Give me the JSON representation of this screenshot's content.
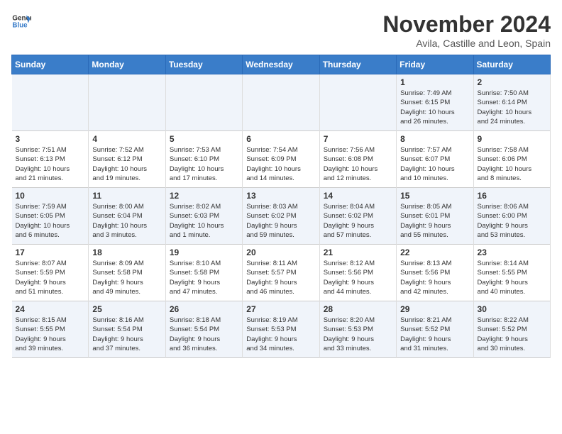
{
  "logo": {
    "line1": "General",
    "line2": "Blue"
  },
  "title": "November 2024",
  "subtitle": "Avila, Castille and Leon, Spain",
  "days_of_week": [
    "Sunday",
    "Monday",
    "Tuesday",
    "Wednesday",
    "Thursday",
    "Friday",
    "Saturday"
  ],
  "weeks": [
    [
      {
        "day": "",
        "info": ""
      },
      {
        "day": "",
        "info": ""
      },
      {
        "day": "",
        "info": ""
      },
      {
        "day": "",
        "info": ""
      },
      {
        "day": "",
        "info": ""
      },
      {
        "day": "1",
        "info": "Sunrise: 7:49 AM\nSunset: 6:15 PM\nDaylight: 10 hours\nand 26 minutes."
      },
      {
        "day": "2",
        "info": "Sunrise: 7:50 AM\nSunset: 6:14 PM\nDaylight: 10 hours\nand 24 minutes."
      }
    ],
    [
      {
        "day": "3",
        "info": "Sunrise: 7:51 AM\nSunset: 6:13 PM\nDaylight: 10 hours\nand 21 minutes."
      },
      {
        "day": "4",
        "info": "Sunrise: 7:52 AM\nSunset: 6:12 PM\nDaylight: 10 hours\nand 19 minutes."
      },
      {
        "day": "5",
        "info": "Sunrise: 7:53 AM\nSunset: 6:10 PM\nDaylight: 10 hours\nand 17 minutes."
      },
      {
        "day": "6",
        "info": "Sunrise: 7:54 AM\nSunset: 6:09 PM\nDaylight: 10 hours\nand 14 minutes."
      },
      {
        "day": "7",
        "info": "Sunrise: 7:56 AM\nSunset: 6:08 PM\nDaylight: 10 hours\nand 12 minutes."
      },
      {
        "day": "8",
        "info": "Sunrise: 7:57 AM\nSunset: 6:07 PM\nDaylight: 10 hours\nand 10 minutes."
      },
      {
        "day": "9",
        "info": "Sunrise: 7:58 AM\nSunset: 6:06 PM\nDaylight: 10 hours\nand 8 minutes."
      }
    ],
    [
      {
        "day": "10",
        "info": "Sunrise: 7:59 AM\nSunset: 6:05 PM\nDaylight: 10 hours\nand 6 minutes."
      },
      {
        "day": "11",
        "info": "Sunrise: 8:00 AM\nSunset: 6:04 PM\nDaylight: 10 hours\nand 3 minutes."
      },
      {
        "day": "12",
        "info": "Sunrise: 8:02 AM\nSunset: 6:03 PM\nDaylight: 10 hours\nand 1 minute."
      },
      {
        "day": "13",
        "info": "Sunrise: 8:03 AM\nSunset: 6:02 PM\nDaylight: 9 hours\nand 59 minutes."
      },
      {
        "day": "14",
        "info": "Sunrise: 8:04 AM\nSunset: 6:02 PM\nDaylight: 9 hours\nand 57 minutes."
      },
      {
        "day": "15",
        "info": "Sunrise: 8:05 AM\nSunset: 6:01 PM\nDaylight: 9 hours\nand 55 minutes."
      },
      {
        "day": "16",
        "info": "Sunrise: 8:06 AM\nSunset: 6:00 PM\nDaylight: 9 hours\nand 53 minutes."
      }
    ],
    [
      {
        "day": "17",
        "info": "Sunrise: 8:07 AM\nSunset: 5:59 PM\nDaylight: 9 hours\nand 51 minutes."
      },
      {
        "day": "18",
        "info": "Sunrise: 8:09 AM\nSunset: 5:58 PM\nDaylight: 9 hours\nand 49 minutes."
      },
      {
        "day": "19",
        "info": "Sunrise: 8:10 AM\nSunset: 5:58 PM\nDaylight: 9 hours\nand 47 minutes."
      },
      {
        "day": "20",
        "info": "Sunrise: 8:11 AM\nSunset: 5:57 PM\nDaylight: 9 hours\nand 46 minutes."
      },
      {
        "day": "21",
        "info": "Sunrise: 8:12 AM\nSunset: 5:56 PM\nDaylight: 9 hours\nand 44 minutes."
      },
      {
        "day": "22",
        "info": "Sunrise: 8:13 AM\nSunset: 5:56 PM\nDaylight: 9 hours\nand 42 minutes."
      },
      {
        "day": "23",
        "info": "Sunrise: 8:14 AM\nSunset: 5:55 PM\nDaylight: 9 hours\nand 40 minutes."
      }
    ],
    [
      {
        "day": "24",
        "info": "Sunrise: 8:15 AM\nSunset: 5:55 PM\nDaylight: 9 hours\nand 39 minutes."
      },
      {
        "day": "25",
        "info": "Sunrise: 8:16 AM\nSunset: 5:54 PM\nDaylight: 9 hours\nand 37 minutes."
      },
      {
        "day": "26",
        "info": "Sunrise: 8:18 AM\nSunset: 5:54 PM\nDaylight: 9 hours\nand 36 minutes."
      },
      {
        "day": "27",
        "info": "Sunrise: 8:19 AM\nSunset: 5:53 PM\nDaylight: 9 hours\nand 34 minutes."
      },
      {
        "day": "28",
        "info": "Sunrise: 8:20 AM\nSunset: 5:53 PM\nDaylight: 9 hours\nand 33 minutes."
      },
      {
        "day": "29",
        "info": "Sunrise: 8:21 AM\nSunset: 5:52 PM\nDaylight: 9 hours\nand 31 minutes."
      },
      {
        "day": "30",
        "info": "Sunrise: 8:22 AM\nSunset: 5:52 PM\nDaylight: 9 hours\nand 30 minutes."
      }
    ]
  ]
}
